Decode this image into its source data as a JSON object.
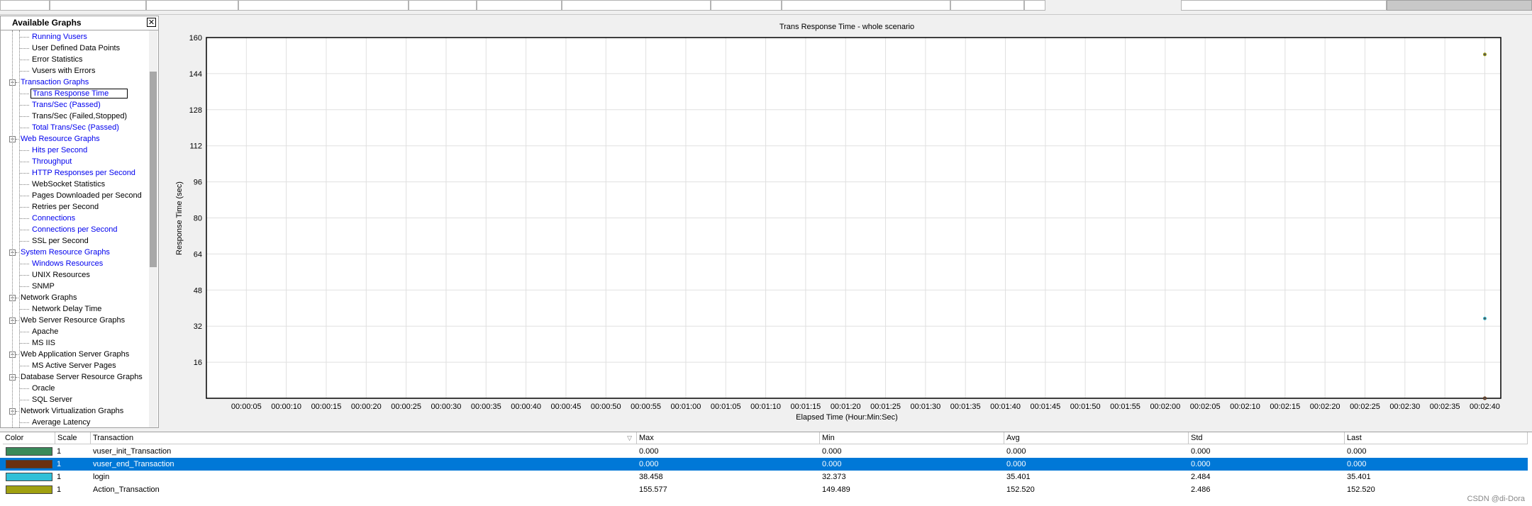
{
  "tree": {
    "title": "Available Graphs",
    "close": "✕",
    "items": [
      {
        "label": "Running Vusers",
        "level": 2,
        "link": true
      },
      {
        "label": "User Defined Data Points",
        "level": 2,
        "link": false
      },
      {
        "label": "Error Statistics",
        "level": 2,
        "link": false
      },
      {
        "label": "Vusers with Errors",
        "level": 2,
        "link": false
      },
      {
        "label": "Transaction Graphs",
        "level": 1,
        "link": true,
        "expander": "−"
      },
      {
        "label": "Trans Response Time",
        "level": 2,
        "link": true,
        "selected": true
      },
      {
        "label": "Trans/Sec (Passed)",
        "level": 2,
        "link": true
      },
      {
        "label": "Trans/Sec (Failed,Stopped)",
        "level": 2,
        "link": false
      },
      {
        "label": "Total Trans/Sec (Passed)",
        "level": 2,
        "link": true
      },
      {
        "label": "Web Resource Graphs",
        "level": 1,
        "link": true,
        "expander": "−"
      },
      {
        "label": "Hits per Second",
        "level": 2,
        "link": true
      },
      {
        "label": "Throughput",
        "level": 2,
        "link": true
      },
      {
        "label": "HTTP Responses per Second",
        "level": 2,
        "link": true
      },
      {
        "label": "WebSocket Statistics",
        "level": 2,
        "link": false
      },
      {
        "label": "Pages Downloaded per Second",
        "level": 2,
        "link": false
      },
      {
        "label": "Retries per Second",
        "level": 2,
        "link": false
      },
      {
        "label": "Connections",
        "level": 2,
        "link": true
      },
      {
        "label": "Connections per Second",
        "level": 2,
        "link": true
      },
      {
        "label": "SSL per Second",
        "level": 2,
        "link": false
      },
      {
        "label": "System Resource Graphs",
        "level": 1,
        "link": true,
        "expander": "−"
      },
      {
        "label": "Windows Resources",
        "level": 2,
        "link": true
      },
      {
        "label": "UNIX Resources",
        "level": 2,
        "link": false
      },
      {
        "label": "SNMP",
        "level": 2,
        "link": false
      },
      {
        "label": "Network Graphs",
        "level": 1,
        "link": false,
        "expander": "−"
      },
      {
        "label": "Network Delay Time",
        "level": 2,
        "link": false
      },
      {
        "label": "Web Server Resource Graphs",
        "level": 1,
        "link": false,
        "expander": "−"
      },
      {
        "label": "Apache",
        "level": 2,
        "link": false
      },
      {
        "label": "MS IIS",
        "level": 2,
        "link": false
      },
      {
        "label": "Web Application Server Graphs",
        "level": 1,
        "link": false,
        "expander": "−"
      },
      {
        "label": "MS Active Server Pages",
        "level": 2,
        "link": false
      },
      {
        "label": "Database Server Resource Graphs",
        "level": 1,
        "link": false,
        "expander": "−"
      },
      {
        "label": "Oracle",
        "level": 2,
        "link": false
      },
      {
        "label": "SQL Server",
        "level": 2,
        "link": false
      },
      {
        "label": "Network Virtualization Graphs",
        "level": 1,
        "link": false,
        "expander": "−"
      },
      {
        "label": "Average Latency",
        "level": 2,
        "link": false
      }
    ]
  },
  "chart_data": {
    "type": "scatter",
    "title": "Trans Response Time - whole scenario",
    "xlabel": "Elapsed Time (Hour:Min:Sec)",
    "ylabel": "Response Time (sec)",
    "ylim": [
      0,
      160
    ],
    "yticks": [
      16,
      32,
      48,
      64,
      80,
      96,
      112,
      128,
      144,
      160
    ],
    "xlim_seconds": [
      0,
      162
    ],
    "xticks": [
      "00:00:05",
      "00:00:10",
      "00:00:15",
      "00:00:20",
      "00:00:25",
      "00:00:30",
      "00:00:35",
      "00:00:40",
      "00:00:45",
      "00:00:50",
      "00:00:55",
      "00:01:00",
      "00:01:05",
      "00:01:10",
      "00:01:15",
      "00:01:20",
      "00:01:25",
      "00:01:30",
      "00:01:35",
      "00:01:40",
      "00:01:45",
      "00:01:50",
      "00:01:55",
      "00:02:00",
      "00:02:05",
      "00:02:10",
      "00:02:15",
      "00:02:20",
      "00:02:25",
      "00:02:30",
      "00:02:35",
      "00:02:40"
    ],
    "grid": true,
    "series": [
      {
        "name": "vuser_init_Transaction",
        "color": "#3a8a5a",
        "points": [
          [
            160,
            0.0
          ]
        ]
      },
      {
        "name": "vuser_end_Transaction",
        "color": "#6b3010",
        "points": [
          [
            160,
            0.0
          ]
        ]
      },
      {
        "name": "login",
        "color": "#30c0d8",
        "points": [
          [
            160,
            35.401
          ]
        ]
      },
      {
        "name": "Action_Transaction",
        "color": "#a0a010",
        "points": [
          [
            160,
            152.52
          ]
        ]
      }
    ]
  },
  "legend": {
    "headers": {
      "color": "Color",
      "scale": "Scale",
      "transaction": "Transaction",
      "max": "Max",
      "min": "Min",
      "avg": "Avg",
      "std": "Std",
      "last": "Last"
    },
    "rows": [
      {
        "color": "#3a8a5a",
        "scale": "1",
        "transaction": "vuser_init_Transaction",
        "max": "0.000",
        "min": "0.000",
        "avg": "0.000",
        "std": "0.000",
        "last": "0.000"
      },
      {
        "color": "#6b3010",
        "scale": "1",
        "transaction": "vuser_end_Transaction",
        "max": "0.000",
        "min": "0.000",
        "avg": "0.000",
        "std": "0.000",
        "last": "0.000",
        "selected": true
      },
      {
        "color": "#30c0d8",
        "scale": "1",
        "transaction": "login",
        "max": "38.458",
        "min": "32.373",
        "avg": "35.401",
        "std": "2.484",
        "last": "35.401"
      },
      {
        "color": "#a0a010",
        "scale": "1",
        "transaction": "Action_Transaction",
        "max": "155.577",
        "min": "149.489",
        "avg": "152.520",
        "std": "2.486",
        "last": "152.520"
      }
    ]
  },
  "watermark": "CSDN @di-Dora"
}
